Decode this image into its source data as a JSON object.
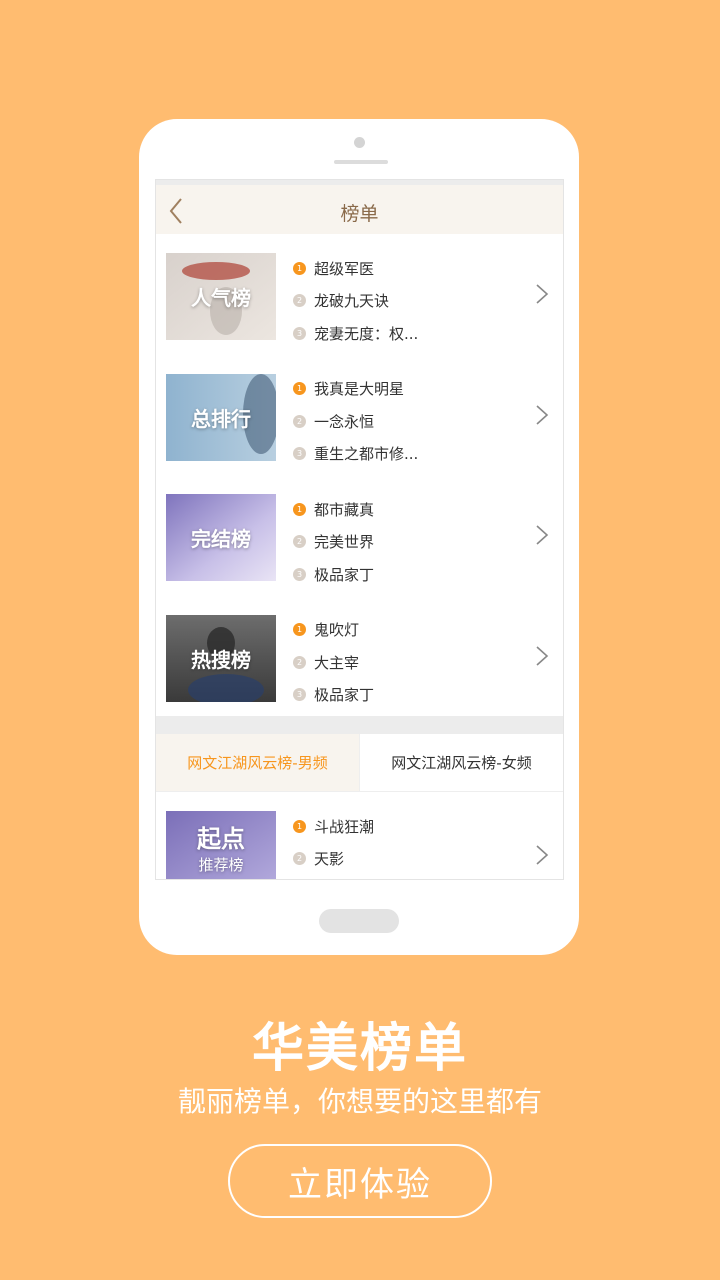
{
  "app": {
    "title": "榜单"
  },
  "rank_lists": [
    {
      "cover_label": "人气榜",
      "colors": [
        "#c9c2bd",
        "#e6dfd9",
        "#b04a3e"
      ],
      "entries": [
        {
          "rank": "1",
          "name": "超级军医"
        },
        {
          "rank": "2",
          "name": "龙破九天诀"
        },
        {
          "rank": "3",
          "name": "宠妻无度：权..."
        }
      ]
    },
    {
      "cover_label": "总排行",
      "colors": [
        "#7fa7c4",
        "#a9c4da",
        "#3b5470"
      ],
      "entries": [
        {
          "rank": "1",
          "name": "我真是大明星"
        },
        {
          "rank": "2",
          "name": "一念永恒"
        },
        {
          "rank": "3",
          "name": "重生之都市修..."
        }
      ]
    },
    {
      "cover_label": "完结榜",
      "colors": [
        "#8f86c6",
        "#cfc6ea",
        "#6a5aa8"
      ],
      "entries": [
        {
          "rank": "1",
          "name": "都市藏真"
        },
        {
          "rank": "2",
          "name": "完美世界"
        },
        {
          "rank": "3",
          "name": "极品家丁"
        }
      ]
    },
    {
      "cover_label": "热搜榜",
      "colors": [
        "#4a4a4a",
        "#8a8a8a",
        "#2a3e6a"
      ],
      "entries": [
        {
          "rank": "1",
          "name": "鬼吹灯"
        },
        {
          "rank": "2",
          "name": "大主宰"
        },
        {
          "rank": "3",
          "name": "极品家丁"
        }
      ]
    }
  ],
  "tabs": [
    {
      "label": "网文江湖风云榜-男频",
      "active": true
    },
    {
      "label": "网文江湖风云榜-女频",
      "active": false
    }
  ],
  "bottom_list": {
    "cover_label_main": "起点",
    "cover_label_sub": "推荐榜",
    "entries": [
      {
        "rank": "1",
        "name": "斗战狂潮"
      },
      {
        "rank": "2",
        "name": "天影"
      }
    ]
  },
  "promo": {
    "headline": "华美榜单",
    "subline": "靓丽榜单，你想要的这里都有",
    "cta_label": "立即体验"
  },
  "colors": {
    "background": "#FFBC70",
    "accent": "#F7961E"
  }
}
